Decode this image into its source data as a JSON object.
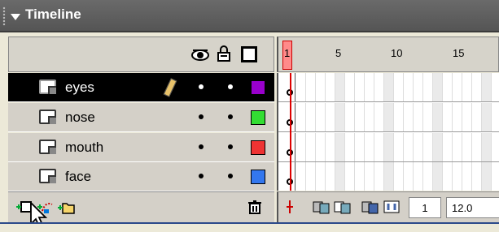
{
  "panel": {
    "title": "Timeline"
  },
  "header": {
    "icons": [
      "eye-icon",
      "lock-icon",
      "outline-icon"
    ]
  },
  "ruler": {
    "current_frame": "1",
    "labels": [
      "5",
      "10",
      "15"
    ]
  },
  "layers": [
    {
      "name": "eyes",
      "selected": true,
      "color": "#9900cc",
      "editing": true
    },
    {
      "name": "nose",
      "selected": false,
      "color": "#33dd33",
      "editing": false
    },
    {
      "name": "mouth",
      "selected": false,
      "color": "#ee3333",
      "editing": false
    },
    {
      "name": "face",
      "selected": false,
      "color": "#3377ee",
      "editing": false
    }
  ],
  "bottom": {
    "current_frame": "1",
    "frame_rate": "12.0"
  }
}
